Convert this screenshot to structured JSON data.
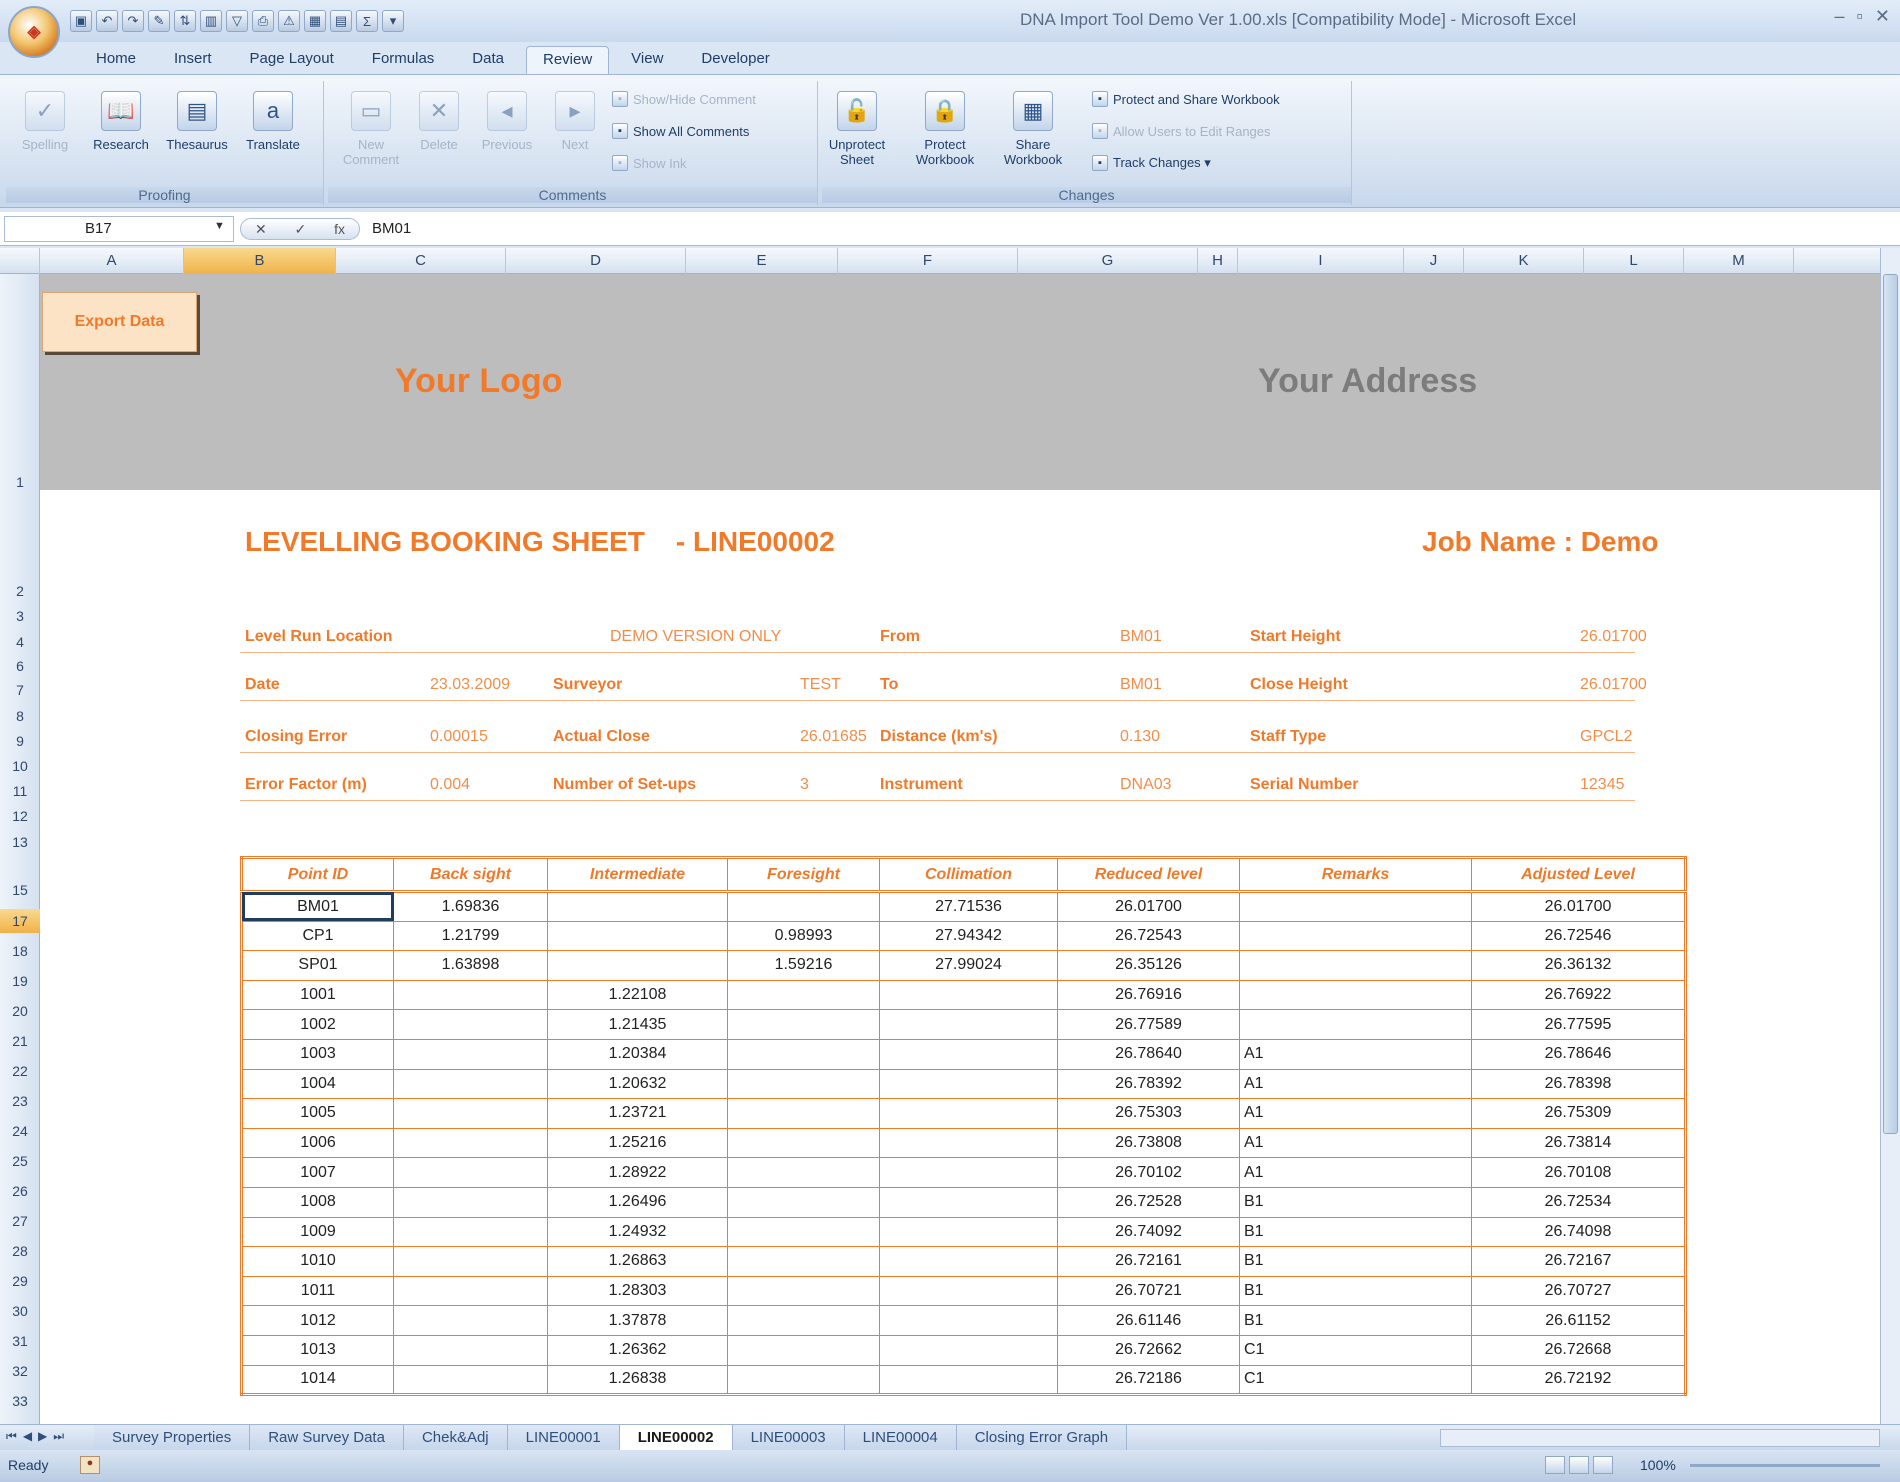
{
  "window": {
    "title": "DNA Import Tool Demo Ver 1.00.xls [Compatibility Mode] - Microsoft Excel",
    "office_button_label": "Office",
    "controls": [
      "–",
      "▫",
      "✕"
    ]
  },
  "ribbon": {
    "tabs": [
      "Home",
      "Insert",
      "Page Layout",
      "Formulas",
      "Data",
      "Review",
      "View",
      "Developer"
    ],
    "active_tab": "Review",
    "groups": {
      "proofing": {
        "label": "Proofing",
        "buttons": [
          {
            "label": "Spelling",
            "icon": "spelling-icon",
            "glyph": "✓",
            "enabled": false
          },
          {
            "label": "Research",
            "icon": "research-icon",
            "glyph": "📖",
            "enabled": true
          },
          {
            "label": "Thesaurus",
            "icon": "thesaurus-icon",
            "glyph": "▤",
            "enabled": true
          },
          {
            "label": "Translate",
            "icon": "translate-icon",
            "glyph": "a",
            "enabled": true
          }
        ]
      },
      "comments": {
        "label": "Comments",
        "buttons": [
          {
            "label": "New Comment",
            "icon": "new-comment-icon",
            "glyph": "▭",
            "enabled": false
          },
          {
            "label": "Delete",
            "icon": "delete-comment-icon",
            "glyph": "✕",
            "enabled": false
          },
          {
            "label": "Previous",
            "icon": "previous-comment-icon",
            "glyph": "◂",
            "enabled": false
          },
          {
            "label": "Next",
            "icon": "next-comment-icon",
            "glyph": "▸",
            "enabled": false
          }
        ],
        "small_buttons": [
          {
            "label": "Show/Hide Comment",
            "enabled": false
          },
          {
            "label": "Show All Comments",
            "enabled": true
          },
          {
            "label": "Show Ink",
            "enabled": false
          }
        ]
      },
      "changes": {
        "label": "Changes",
        "buttons": [
          {
            "label": "Unprotect Sheet",
            "icon": "unprotect-sheet-icon",
            "glyph": "🔓",
            "enabled": true
          },
          {
            "label": "Protect Workbook",
            "icon": "protect-workbook-icon",
            "glyph": "🔒",
            "enabled": true
          },
          {
            "label": "Share Workbook",
            "icon": "share-workbook-icon",
            "glyph": "▦",
            "enabled": true
          }
        ],
        "small_buttons": [
          {
            "label": "Protect and Share Workbook",
            "enabled": true
          },
          {
            "label": "Allow Users to Edit Ranges",
            "enabled": false
          },
          {
            "label": "Track Changes ▾",
            "enabled": true
          }
        ]
      }
    }
  },
  "formula_bar": {
    "name_box": "B17",
    "fx": "fx",
    "content": "BM01"
  },
  "columns": [
    "A",
    "B",
    "C",
    "D",
    "E",
    "F",
    "G",
    "H",
    "I",
    "J",
    "K",
    "L",
    "M"
  ],
  "selected_column": "B",
  "row_numbers": [
    "1",
    "2",
    "3",
    "4",
    "6",
    "7",
    "8",
    "9",
    "10",
    "11",
    "12",
    "13",
    "15",
    "17",
    "18",
    "19",
    "20",
    "21",
    "22",
    "23",
    "24",
    "25",
    "26",
    "27",
    "28",
    "29",
    "30",
    "31",
    "32",
    "33"
  ],
  "selected_row": "17",
  "sheet": {
    "export_button": "Export Data",
    "logo": "Your Logo",
    "address": "Your Address",
    "title": "LEVELLING BOOKING SHEET    - LINE00002",
    "job_name": "Job Name : Demo",
    "info_rows": [
      [
        {
          "label": "Level Run Location",
          "value": "DEMO VERSION ONLY"
        },
        {
          "label": "From",
          "value": "BM01"
        },
        {
          "label": "Start Height",
          "value": "26.01700"
        }
      ],
      [
        {
          "label": "Date",
          "value": "23.03.2009"
        },
        {
          "label": "Surveyor",
          "value": "TEST"
        },
        {
          "label": "To",
          "value": "BM01"
        },
        {
          "label": "Close Height",
          "value": "26.01700"
        }
      ],
      [
        {
          "label": "Closing Error",
          "value": "0.00015"
        },
        {
          "label": "Actual Close",
          "value": "26.01685"
        },
        {
          "label": "Distance (km's)",
          "value": "0.130"
        },
        {
          "label": "Staff Type",
          "value": "GPCL2"
        }
      ],
      [
        {
          "label": "Error Factor (m)",
          "value": "0.004"
        },
        {
          "label": "Number of Set-ups",
          "value": "3"
        },
        {
          "label": "Instrument",
          "value": "DNA03"
        },
        {
          "label": "Serial Number",
          "value": "12345"
        }
      ]
    ],
    "table": {
      "headers": [
        "Point ID",
        "Back sight",
        "Intermediate",
        "Foresight",
        "Collimation",
        "Reduced level",
        "Remarks",
        "Adjusted Level"
      ],
      "rows": [
        [
          "BM01",
          "1.69836",
          "",
          "",
          "27.71536",
          "26.01700",
          "",
          "26.01700"
        ],
        [
          "CP1",
          "1.21799",
          "",
          "0.98993",
          "27.94342",
          "26.72543",
          "",
          "26.72546"
        ],
        [
          "SP01",
          "1.63898",
          "",
          "1.59216",
          "27.99024",
          "26.35126",
          "",
          "26.36132"
        ],
        [
          "1001",
          "",
          "1.22108",
          "",
          "",
          "26.76916",
          "",
          "26.76922"
        ],
        [
          "1002",
          "",
          "1.21435",
          "",
          "",
          "26.77589",
          "",
          "26.77595"
        ],
        [
          "1003",
          "",
          "1.20384",
          "",
          "",
          "26.78640",
          "A1",
          "26.78646"
        ],
        [
          "1004",
          "",
          "1.20632",
          "",
          "",
          "26.78392",
          "A1",
          "26.78398"
        ],
        [
          "1005",
          "",
          "1.23721",
          "",
          "",
          "26.75303",
          "A1",
          "26.75309"
        ],
        [
          "1006",
          "",
          "1.25216",
          "",
          "",
          "26.73808",
          "A1",
          "26.73814"
        ],
        [
          "1007",
          "",
          "1.28922",
          "",
          "",
          "26.70102",
          "A1",
          "26.70108"
        ],
        [
          "1008",
          "",
          "1.26496",
          "",
          "",
          "26.72528",
          "B1",
          "26.72534"
        ],
        [
          "1009",
          "",
          "1.24932",
          "",
          "",
          "26.74092",
          "B1",
          "26.74098"
        ],
        [
          "1010",
          "",
          "1.26863",
          "",
          "",
          "26.72161",
          "B1",
          "26.72167"
        ],
        [
          "1011",
          "",
          "1.28303",
          "",
          "",
          "26.70721",
          "B1",
          "26.70727"
        ],
        [
          "1012",
          "",
          "1.37878",
          "",
          "",
          "26.61146",
          "B1",
          "26.61152"
        ],
        [
          "1013",
          "",
          "1.26362",
          "",
          "",
          "26.72662",
          "C1",
          "26.72668"
        ],
        [
          "1014",
          "",
          "1.26838",
          "",
          "",
          "26.72186",
          "C1",
          "26.72192"
        ]
      ]
    }
  },
  "sheet_tabs": [
    "Survey Properties",
    "Raw Survey Data",
    "Chek&Adj",
    "LINE00001",
    "LINE00002",
    "LINE00003",
    "LINE00004",
    "Closing Error Graph"
  ],
  "active_sheet_tab": "LINE00002",
  "status": {
    "ready": "Ready",
    "zoom": "100%"
  },
  "colors": {
    "accent_orange": "#f07a2a",
    "banner_gray": "#bdbdbd",
    "ribbon_blue": "#dbe6f4"
  }
}
